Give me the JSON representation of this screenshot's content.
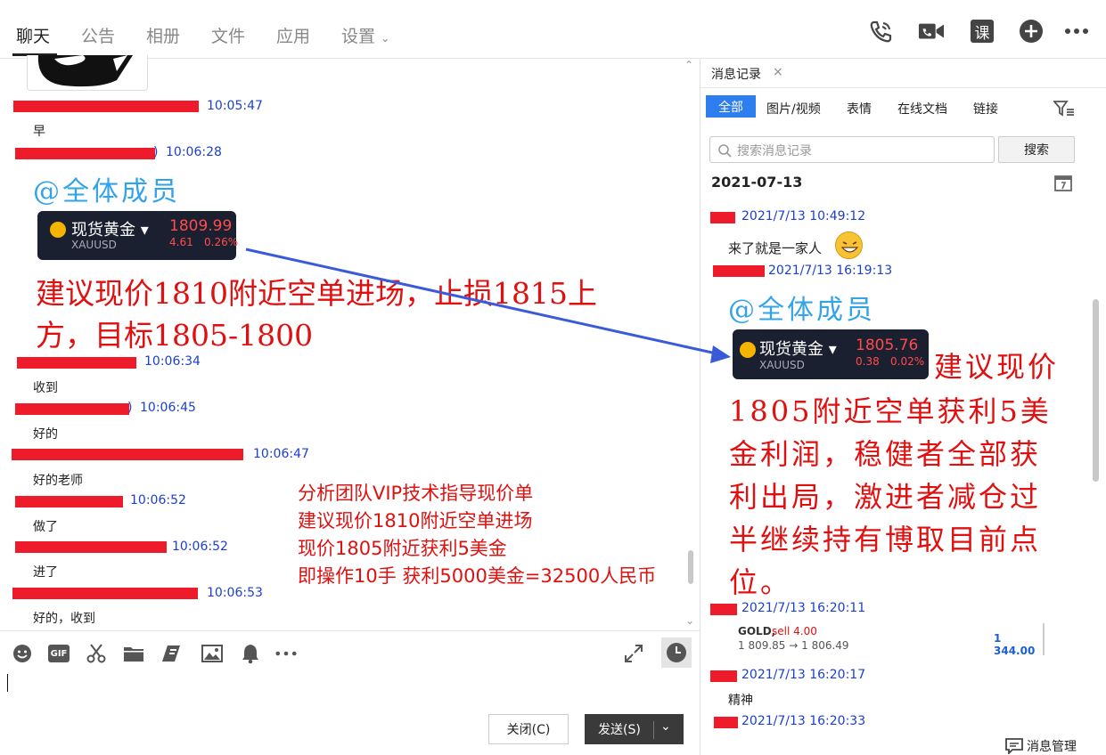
{
  "tabs": [
    {
      "label": "聊天"
    },
    {
      "label": "公告"
    },
    {
      "label": "相册"
    },
    {
      "label": "文件"
    },
    {
      "label": "应用"
    },
    {
      "label": "设置"
    }
  ],
  "header_icons": [
    "phone-icon",
    "video-call-icon",
    "course-icon",
    "add-icon",
    "more-icon"
  ],
  "chat": {
    "messages": [
      {
        "time": "10:05:47",
        "text": "早"
      },
      {
        "time": "10:06:28",
        "text": "@全体成员"
      },
      {
        "time": "10:06:34",
        "text": "收到"
      },
      {
        "time": "10:06:45",
        "text": "好的"
      },
      {
        "time": "10:06:47",
        "text": "好的老师"
      },
      {
        "time": "10:06:52",
        "text": "做了"
      },
      {
        "time": "10:06:52",
        "text": "进了"
      },
      {
        "time": "10:06:53",
        "text": "好的，收到"
      }
    ],
    "quote": {
      "name": "现货黄金",
      "symbol": "XAUUSD",
      "price": "1809.99",
      "change": "4.61",
      "pct": "0.26%"
    },
    "big_text_1": "建议现价1810附近空单进场，止损1815上",
    "big_text_2": "方，目标1805-1800",
    "annotation": [
      "分析团队VIP技术指导现价单",
      "建议现价1810附近空单进场",
      "现价1805附近获利5美金",
      "即操作10手 获利5000美金=32500人民币"
    ]
  },
  "composer": {
    "close_label": "关闭(C)",
    "send_label": "发送(S)"
  },
  "history": {
    "tab_label": "消息记录",
    "filters": [
      {
        "label": "全部"
      },
      {
        "label": "图片/视频"
      },
      {
        "label": "表情"
      },
      {
        "label": "在线文档"
      },
      {
        "label": "链接"
      }
    ],
    "search_placeholder": "搜索消息记录",
    "search_button": "搜索",
    "date": "2021-07-13",
    "entries": [
      {
        "time": "2021/7/13 10:49:12",
        "text": "来了就是一家人"
      },
      {
        "time": "2021/7/13 16:19:13",
        "text": "@全体成员"
      },
      {
        "time": "2021/7/13 16:20:11",
        "text": ""
      },
      {
        "time": "2021/7/13 16:20:17",
        "text": "精神"
      },
      {
        "time": "2021/7/13 16:20:33",
        "text": ""
      }
    ],
    "quote": {
      "name": "现货黄金",
      "symbol": "XAUUSD",
      "price": "1805.76",
      "change": "0.38",
      "pct": "0.02%"
    },
    "big_text": [
      "建议现价",
      "1805附近空单获利5美",
      "金利润，稳健者全部获",
      "利出局，激进者减仓过",
      "半继续持有博取目前点",
      "位。"
    ],
    "trade": {
      "symbol": "GOLD,",
      "side": "sell 4.00",
      "prices": "1 809.85 → 1 806.49",
      "profit": "1 344.00"
    },
    "manage_label": "消息管理"
  }
}
